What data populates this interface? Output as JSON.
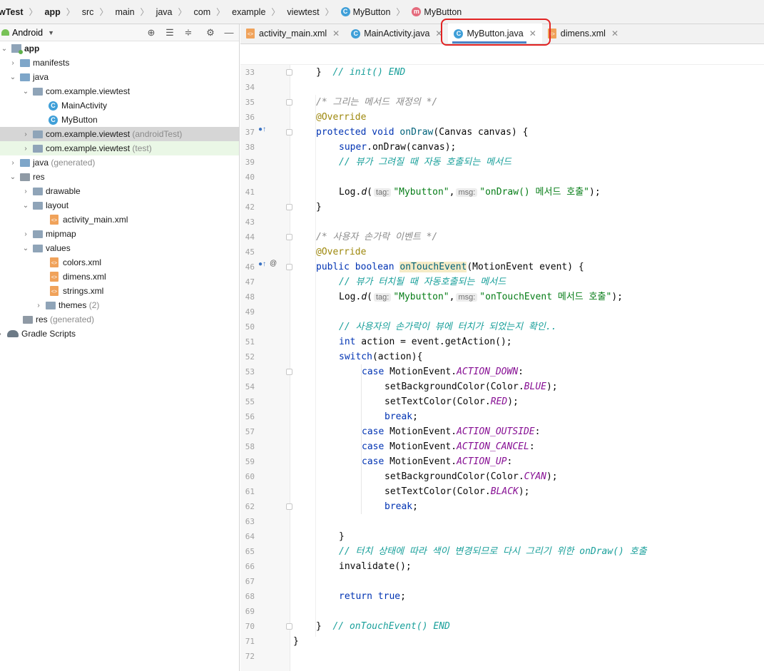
{
  "breadcrumb": [
    "wTest",
    "app",
    "src",
    "main",
    "java",
    "com",
    "example",
    "viewtest",
    "MyButton",
    "MyButton"
  ],
  "panel": {
    "view": "Android"
  },
  "tree": [
    {
      "label": "app",
      "extra": ""
    },
    {
      "label": "manifests",
      "extra": ""
    },
    {
      "label": "java",
      "extra": ""
    },
    {
      "label": "com.example.viewtest",
      "extra": ""
    },
    {
      "label": "MainActivity",
      "extra": ""
    },
    {
      "label": "MyButton",
      "extra": ""
    },
    {
      "label": "com.example.viewtest",
      "extra": "(androidTest)"
    },
    {
      "label": "com.example.viewtest",
      "extra": "(test)"
    },
    {
      "label": "java",
      "extra": "(generated)"
    },
    {
      "label": "res",
      "extra": ""
    },
    {
      "label": "drawable",
      "extra": ""
    },
    {
      "label": "layout",
      "extra": ""
    },
    {
      "label": "activity_main.xml",
      "extra": ""
    },
    {
      "label": "mipmap",
      "extra": ""
    },
    {
      "label": "values",
      "extra": ""
    },
    {
      "label": "colors.xml",
      "extra": ""
    },
    {
      "label": "dimens.xml",
      "extra": ""
    },
    {
      "label": "strings.xml",
      "extra": ""
    },
    {
      "label": "themes",
      "extra": "(2)"
    },
    {
      "label": "res",
      "extra": "(generated)"
    },
    {
      "label": "Gradle Scripts",
      "extra": ""
    }
  ],
  "tabs": [
    {
      "label": "activity_main.xml"
    },
    {
      "label": "MainActivity.java"
    },
    {
      "label": "MyButton.java"
    },
    {
      "label": "dimens.xml"
    }
  ],
  "code": {
    "line_numbers": [
      33,
      34,
      35,
      36,
      37,
      38,
      39,
      40,
      41,
      42,
      43,
      44,
      45,
      46,
      47,
      48,
      49,
      50,
      51,
      52,
      53,
      54,
      55,
      56,
      57,
      58,
      59,
      60,
      61,
      62,
      63,
      64,
      65,
      66,
      67,
      68,
      69,
      70,
      71,
      72
    ],
    "hints": {
      "tag": "tag:",
      "msg": "msg:"
    },
    "l33_brace": "}",
    "l33_comment": "// init() END",
    "l35_comment": "/* 그리는 메서드 재정의 */",
    "l36_ann": "@Override",
    "l37_kw1": "protected",
    "l37_kw2": "void",
    "l37_fn": "onDraw",
    "l37_rest": "(Canvas canvas) {",
    "l38_kw": "super",
    "l38_rest": ".onDraw(canvas);",
    "l39_comment": "// 뷰가 그려질 때 자동 호출되는 메서드",
    "l41_pre": "Log.",
    "l41_fn": "d",
    "l41_open": "(",
    "l41_str1": "\"Mybutton\"",
    "l41_comma": ",",
    "l41_str2": "\"onDraw() 메서드 호출\"",
    "l41_close": ");",
    "l42": "}",
    "l44_comment": "/* 사용자 손가락 이벤트 */",
    "l45_ann": "@Override",
    "l46_kw1": "public",
    "l46_kw2": "boolean",
    "l46_fn": "onTouchEvent",
    "l46_rest": "(MotionEvent event) {",
    "l47_comment": "// 뷰가 터치될 때 자동호출되는 메서드",
    "l48_pre": "Log.",
    "l48_fn": "d",
    "l48_open": "(",
    "l48_str1": "\"Mybutton\"",
    "l48_comma": ",",
    "l48_str2": "\"onTouchEvent 메서드 호출\"",
    "l48_close": ");",
    "l50_comment": "// 사용자의 손가락이 뷰에 터치가 되었는지 확인..",
    "l51_kw": "int",
    "l51_rest": " action = event.getAction();",
    "l52_kw": "switch",
    "l52_rest": "(action){",
    "l53_kw": "case",
    "l53_mid": " MotionEvent.",
    "l53_const": "ACTION_DOWN",
    "l53_end": ":",
    "l54_pre": "setBackgroundColor(Color.",
    "l54_const": "BLUE",
    "l54_end": ");",
    "l55_pre": "setTextColor(Color.",
    "l55_const": "RED",
    "l55_end": ");",
    "l56_kw": "break",
    "l56_end": ";",
    "l57_kw": "case",
    "l57_mid": " MotionEvent.",
    "l57_const": "ACTION_OUTSIDE",
    "l57_end": ":",
    "l58_kw": "case",
    "l58_mid": " MotionEvent.",
    "l58_const": "ACTION_CANCEL",
    "l58_end": ":",
    "l59_kw": "case",
    "l59_mid": " MotionEvent.",
    "l59_const": "ACTION_UP",
    "l59_end": ":",
    "l60_pre": "setBackgroundColor(Color.",
    "l60_const": "CYAN",
    "l60_end": ");",
    "l61_pre": "setTextColor(Color.",
    "l61_const": "BLACK",
    "l61_end": ");",
    "l62_kw": "break",
    "l62_end": ";",
    "l64": "}",
    "l65_comment": "// 터치 상태에 따라 색이 변경되므로 다시 그리기 위한 onDraw() 호출",
    "l66": "invalidate();",
    "l68_kw1": "return",
    "l68_kw2": "true",
    "l68_end": ";",
    "l70_brace": "}",
    "l70_comment": "// onTouchEvent() END",
    "l71": "}"
  }
}
